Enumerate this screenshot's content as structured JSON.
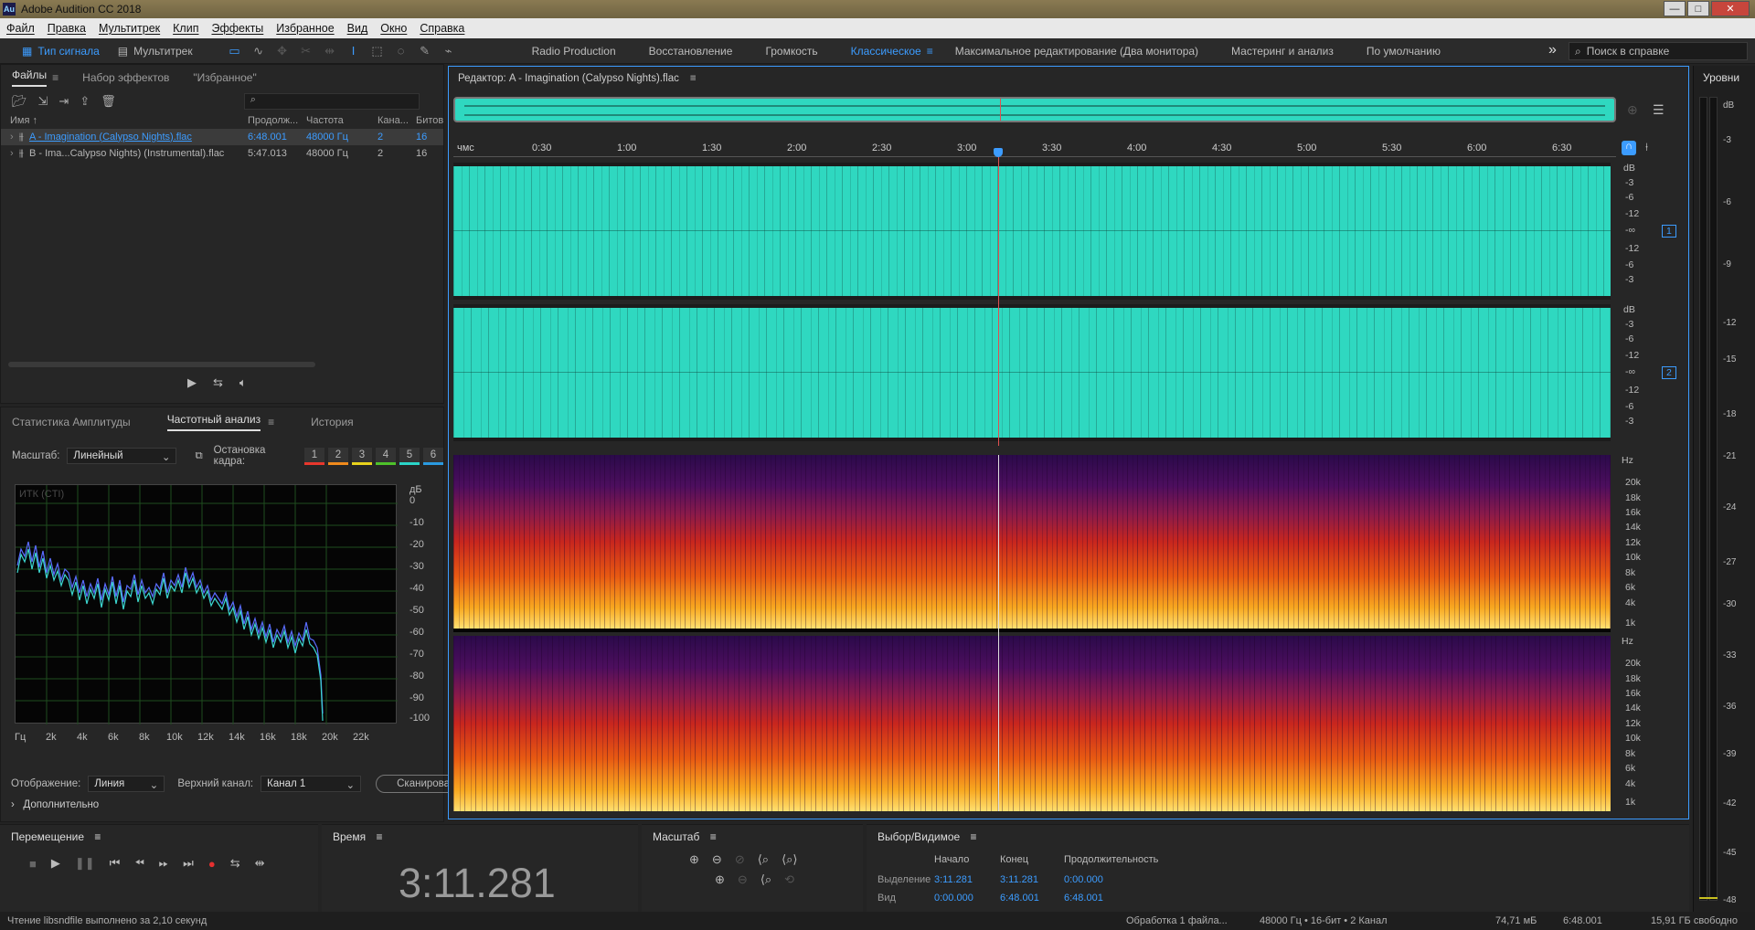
{
  "window": {
    "title": "Adobe Audition CC 2018",
    "app_badge": "Au",
    "controls": [
      "—",
      "□",
      "✕"
    ]
  },
  "menu": [
    "Файл",
    "Правка",
    "Мультитрек",
    "Клип",
    "Эффекты",
    "Избранное",
    "Вид",
    "Окно",
    "Справка"
  ],
  "toolbar": {
    "mode_waveform": "Тип сигнала",
    "mode_multitrack": "Мультитрек",
    "workspaces": [
      "Radio Production",
      "Восстановление",
      "Громкость",
      "Классическое",
      "Максимальное редактирование (Два монитора)",
      "Мастеринг и анализ",
      "По умолчанию"
    ],
    "active_workspace": "Классическое",
    "overflow": "»",
    "search_placeholder": "Поиск в справке"
  },
  "files_panel": {
    "tabs": [
      "Файлы",
      "Набор эффектов",
      "\"Избранное\""
    ],
    "columns": [
      "Имя ↑",
      "Продолж...",
      "Частота",
      "Кана...",
      "Битов"
    ],
    "rows": [
      {
        "name": "A - Imagination (Calypso Nights).flac",
        "duration": "6:48.001",
        "rate": "48000 Гц",
        "channels": "2",
        "bits": "16",
        "selected": true
      },
      {
        "name": "B - Ima...Calypso Nights) (Instrumental).flac",
        "duration": "5:47.013",
        "rate": "48000 Гц",
        "channels": "2",
        "bits": "16",
        "selected": false
      }
    ]
  },
  "analysis_panel": {
    "tabs": [
      "Статистика Амплитуды",
      "Частотный анализ",
      "История"
    ],
    "scale_label": "Масштаб:",
    "scale_value": "Линейный",
    "freeze_label": "Остановка кадра:",
    "freeze_slots": [
      "1",
      "2",
      "3",
      "4",
      "5",
      "6"
    ],
    "freeze_colors": [
      "#e8372c",
      "#f08a1c",
      "#e8d21c",
      "#4ec22a",
      "#2ad4c8",
      "#2a9ae0"
    ],
    "graph_label": "ИТК (CTI)",
    "db_unit": "дБ",
    "db_ticks": [
      "0",
      "-10",
      "-20",
      "-30",
      "-40",
      "-50",
      "-60",
      "-70",
      "-80",
      "-90",
      "-100"
    ],
    "freq_ticks": [
      "Гц",
      "2k",
      "4k",
      "6k",
      "8k",
      "10k",
      "12k",
      "14k",
      "16k",
      "18k",
      "20k",
      "22k"
    ],
    "display_label": "Отображение:",
    "display_value": "Линия",
    "channel_label": "Верхний канал:",
    "channel_value": "Канал 1",
    "scan_button": "Сканировать",
    "advanced": "Дополнительно"
  },
  "editor": {
    "title": "Редактор: A - Imagination (Calypso Nights).flac",
    "ruler_unit": "чмс",
    "ruler_ticks": [
      "0:30",
      "1:00",
      "1:30",
      "2:00",
      "2:30",
      "3:00",
      "3:30",
      "4:00",
      "4:30",
      "5:00",
      "5:30",
      "6:00",
      "6:30"
    ],
    "db_scale_top": [
      "dB",
      "-3",
      "-6",
      "-12",
      "-∞",
      "-12",
      "-6",
      "-3"
    ],
    "db_scale_bottom": [
      "dB",
      "-3",
      "-6",
      "-12",
      "-∞",
      "-12",
      "-6",
      "-3"
    ],
    "hz_scale": [
      "Hz",
      "20k",
      "18k",
      "16k",
      "14k",
      "12k",
      "10k",
      "8k",
      "6k",
      "4k",
      "1k"
    ],
    "channel_badges": [
      "1",
      "2"
    ],
    "wave_color": "#2fd8c0",
    "playhead_color": "#e05050"
  },
  "levels": {
    "title": "Уровни",
    "ticks": [
      "dB",
      "-3",
      "-6",
      "-9",
      "-12",
      "-15",
      "-18",
      "-21",
      "-24",
      "-27",
      "-30",
      "-33",
      "-36",
      "-39",
      "-42",
      "-45",
      "-48"
    ]
  },
  "transport": {
    "title": "Перемещение"
  },
  "time_panel": {
    "title": "Время",
    "value": "3:11.281"
  },
  "zoom_panel": {
    "title": "Масштаб"
  },
  "selection_panel": {
    "title": "Выбор/Видимое",
    "headers": [
      "Начало",
      "Конец",
      "Продолжительность"
    ],
    "rows": [
      {
        "label": "Выделение",
        "start": "3:11.281",
        "end": "3:11.281",
        "duration": "0:00.000"
      },
      {
        "label": "Вид",
        "start": "0:00.000",
        "end": "6:48.001",
        "duration": "6:48.001"
      }
    ]
  },
  "status": {
    "left": "Чтение libsndfile выполнено за 2,10 секунд",
    "processing": "Обработка 1 файла...",
    "format": "48000 Гц • 16-бит • 2 Канал",
    "size": "74,71 мБ",
    "duration": "6:48.001",
    "free": "15,91 ГБ свободно"
  }
}
